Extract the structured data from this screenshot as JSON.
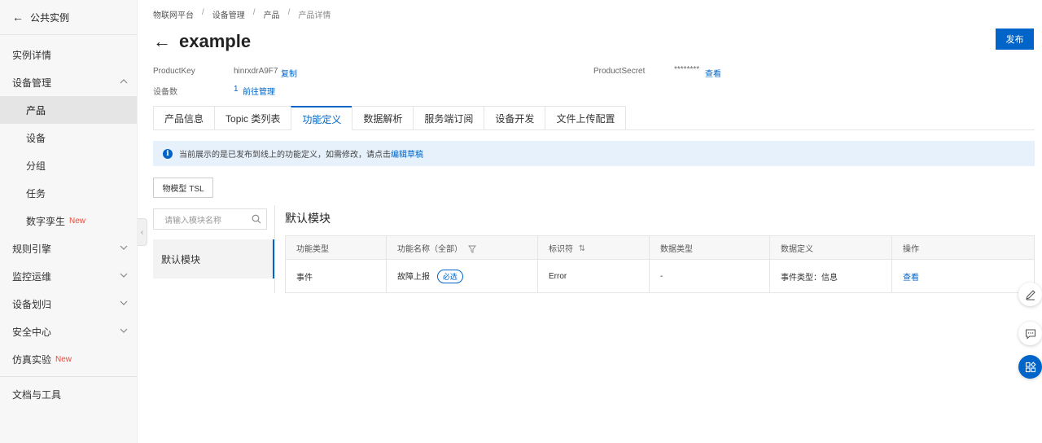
{
  "sidebar": {
    "back_label": "公共实例",
    "items": [
      {
        "label": "实例详情"
      },
      {
        "label": "设备管理"
      },
      {
        "label": "产品"
      },
      {
        "label": "设备"
      },
      {
        "label": "分组"
      },
      {
        "label": "任务"
      },
      {
        "label": "数字孪生",
        "badge": "New"
      },
      {
        "label": "规则引擎"
      },
      {
        "label": "监控运维"
      },
      {
        "label": "设备划归"
      },
      {
        "label": "安全中心"
      },
      {
        "label": "仿真实验",
        "badge": "New"
      },
      {
        "label": "文档与工具"
      }
    ]
  },
  "breadcrumb": [
    "物联网平台",
    "设备管理",
    "产品",
    "产品详情"
  ],
  "breadcrumb_sep": "/",
  "page": {
    "title": "example",
    "publish_label": "发布"
  },
  "meta": {
    "product_key_label": "ProductKey",
    "product_key_value": "hinrxdrA9F7",
    "copy_label": "复制",
    "product_secret_label": "ProductSecret",
    "product_secret_value": "********",
    "view_label": "查看",
    "device_count_label": "设备数",
    "device_count_value": "1",
    "goto_manage_label": "前往管理"
  },
  "tabs": [
    {
      "label": "产品信息"
    },
    {
      "label": "Topic 类列表"
    },
    {
      "label": "功能定义",
      "active": true
    },
    {
      "label": "数据解析"
    },
    {
      "label": "服务端订阅"
    },
    {
      "label": "设备开发"
    },
    {
      "label": "文件上传配置"
    }
  ],
  "notice": {
    "text": "当前展示的是已发布到线上的功能定义，如需修改，请点击",
    "link": "编辑草稿"
  },
  "tsl_button": "物模型 TSL",
  "module": {
    "search_placeholder": "请输入模块名称",
    "list_item": "默认模块",
    "section_title": "默认模块"
  },
  "table": {
    "headers": [
      "功能类型",
      "功能名称（全部）",
      "标识符",
      "数据类型",
      "数据定义",
      "操作"
    ],
    "rows": [
      {
        "type": "事件",
        "name": "故障上报",
        "tag": "必选",
        "identifier": "Error",
        "data_type": "-",
        "definition": "事件类型：信息",
        "action": "查看"
      }
    ]
  },
  "colors": {
    "primary": "#0064c8",
    "new_badge": "#e84a3a",
    "notice_bg": "#e6f1fb"
  }
}
